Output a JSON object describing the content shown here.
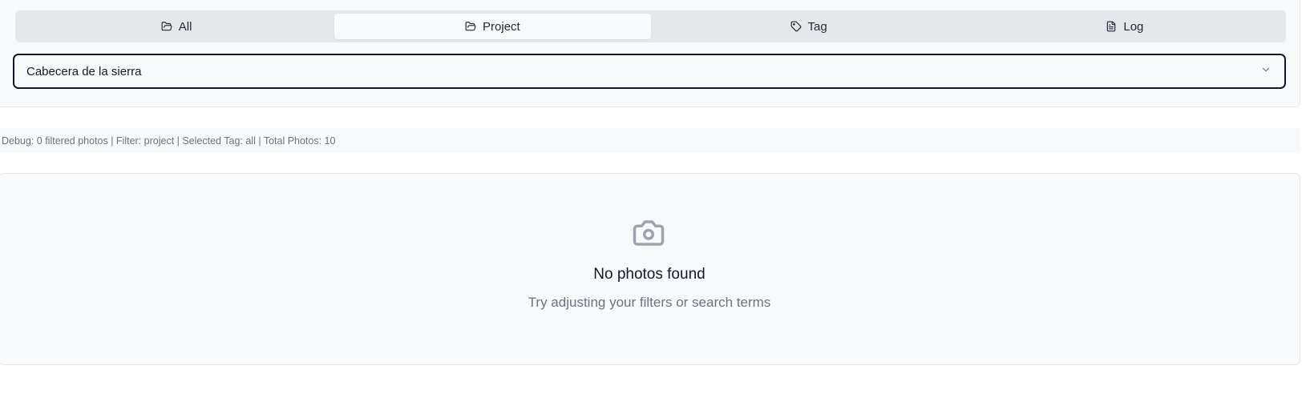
{
  "tabs": [
    {
      "label": "All",
      "icon": "folder-open-icon",
      "active": false
    },
    {
      "label": "Project",
      "icon": "folder-open-icon",
      "active": true
    },
    {
      "label": "Tag",
      "icon": "tag-icon",
      "active": false
    },
    {
      "label": "Log",
      "icon": "file-text-icon",
      "active": false
    }
  ],
  "project_select": {
    "value": "Cabecera de la sierra",
    "icon": "chevron-down-icon"
  },
  "debug": {
    "text": "Debug: 0 filtered photos | Filter: project | Selected Tag: all | Total Photos: 10"
  },
  "empty_state": {
    "icon": "camera-icon",
    "title": "No photos found",
    "subtitle": "Try adjusting your filters or search terms"
  },
  "colors": {
    "tab_bar_bg": "#e5e7eb",
    "card_bg": "#f8f9fb",
    "muted_text": "#6b7280",
    "icon_gray": "#9ca3af",
    "focus_border": "#111827"
  }
}
